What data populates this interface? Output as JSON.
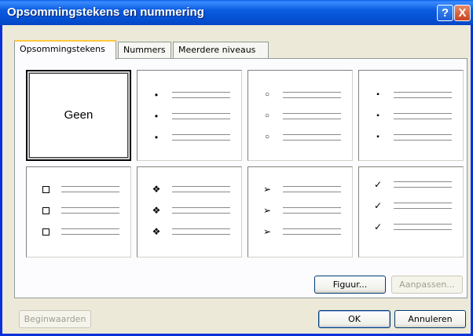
{
  "title": "Opsommingstekens en nummering",
  "titlebar_buttons": {
    "help": "?",
    "close": "X"
  },
  "tabs": [
    {
      "label": "Opsommingstekens",
      "active": true
    },
    {
      "label": "Nummers",
      "active": false
    },
    {
      "label": "Meerdere niveaus",
      "active": false
    }
  ],
  "gallery": {
    "none_label": "Geen",
    "styles": [
      {
        "icon": "none",
        "glyph": ""
      },
      {
        "icon": "filled-dot-bullet-icon",
        "glyph": "•"
      },
      {
        "icon": "hollow-circle-bullet-icon",
        "glyph": "○"
      },
      {
        "icon": "square-bullet-icon",
        "glyph": "▪"
      },
      {
        "icon": "checkbox-bullet-icon",
        "glyph": "❑"
      },
      {
        "icon": "four-diamond-bullet-icon",
        "glyph": "❖"
      },
      {
        "icon": "arrowhead-bullet-icon",
        "glyph": "➢"
      },
      {
        "icon": "checkmark-bullet-icon",
        "glyph": "✓"
      }
    ]
  },
  "buttons": {
    "picture": "Figuur...",
    "customize": "Aanpassen...",
    "reset": "Beginwaarden",
    "ok": "OK",
    "cancel": "Annuleren"
  }
}
